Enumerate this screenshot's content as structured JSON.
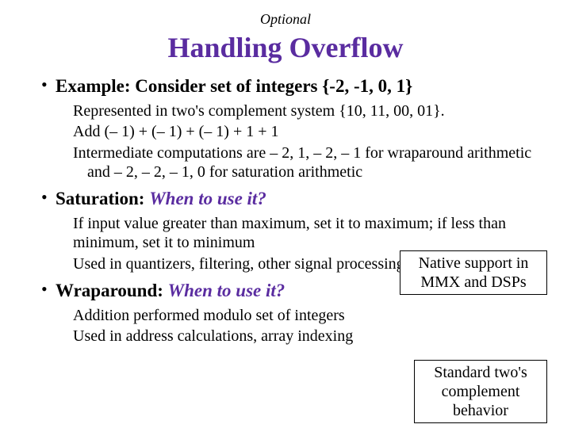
{
  "header": {
    "optional": "Optional",
    "title": "Handling Overflow"
  },
  "bullets": {
    "example": {
      "heading": "Example: Consider set of integers {-2, -1, 0, 1}",
      "line1": "Represented in two's complement system {10, 11, 00, 01}.",
      "line2": "Add (– 1) + (– 1) + (– 1) + 1 + 1",
      "line3": "Intermediate computations are – 2, 1, – 2, – 1 for wraparound arithmetic and – 2, – 2, – 1, 0 for saturation arithmetic"
    },
    "saturation": {
      "heading_prefix": "Saturation: ",
      "heading_q": "When to use it?",
      "line1": "If input value greater than maximum, set it to maximum; if less than minimum, set it to minimum",
      "line2": "Used in quantizers, filtering, other signal processing operators"
    },
    "wraparound": {
      "heading_prefix": "Wraparound: ",
      "heading_q": "When to use it?",
      "line1": "Addition performed modulo set of integers",
      "line2": "Used in address calculations, array indexing"
    }
  },
  "callouts": {
    "saturation": "Native support in MMX and DSPs",
    "wraparound": "Standard two's complement behavior"
  },
  "colors": {
    "accent": "#5a2ca0"
  }
}
